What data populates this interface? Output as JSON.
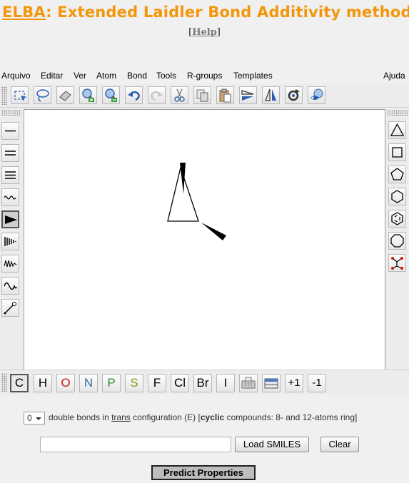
{
  "header": {
    "title_link": "ELBA",
    "title_rest": ": Extended Laidler Bond Additivity method",
    "help_open": "[",
    "help_link": "Help",
    "help_close": "]"
  },
  "menu": {
    "items": [
      "Arquivo",
      "Editar",
      "Ver",
      "Atom",
      "Bond",
      "Tools",
      "R-groups",
      "Templates"
    ],
    "help": "Ajuda"
  },
  "toolbar": {
    "tools": [
      "select-rectangle",
      "lasso",
      "eraser",
      "zoom-in",
      "zoom-out",
      "undo",
      "redo",
      "cut",
      "copy",
      "paste",
      "flip-horizontal",
      "flip-vertical",
      "rotate",
      "clean"
    ]
  },
  "bond_tools": [
    "single-bond",
    "double-bond",
    "triple-bond",
    "any-bond",
    "wedge-bond",
    "hash-bond",
    "wavy-bond",
    "chain",
    "arrow"
  ],
  "ring_tools": [
    "triangle",
    "square",
    "pentagon",
    "hexagon",
    "benzene",
    "octagon",
    "ring-template"
  ],
  "atom_bar": {
    "atoms": [
      "C",
      "H",
      "O",
      "N",
      "P",
      "S",
      "F",
      "Cl",
      "Br",
      "I"
    ],
    "colors": {
      "C": "#000000",
      "H": "#000000",
      "O": "#d01010",
      "N": "#2a6fa8",
      "P": "#2a8a2a",
      "S": "#8a9a10",
      "F": "#000000",
      "Cl": "#000000",
      "Br": "#000000",
      "I": "#000000"
    },
    "charge_plus": "+1",
    "charge_minus": "-1"
  },
  "form": {
    "double_bonds_value": "0",
    "text_a": "double bonds in",
    "text_trans": "trans",
    "text_b": "configuration (E) [",
    "text_cyclic": "cyclic",
    "text_c": "compounds: 8- and 12-atoms ring]",
    "smiles_value": "",
    "load_button": "Load SMILES",
    "clear_button": "Clear",
    "predict_button": "Predict Properties"
  }
}
